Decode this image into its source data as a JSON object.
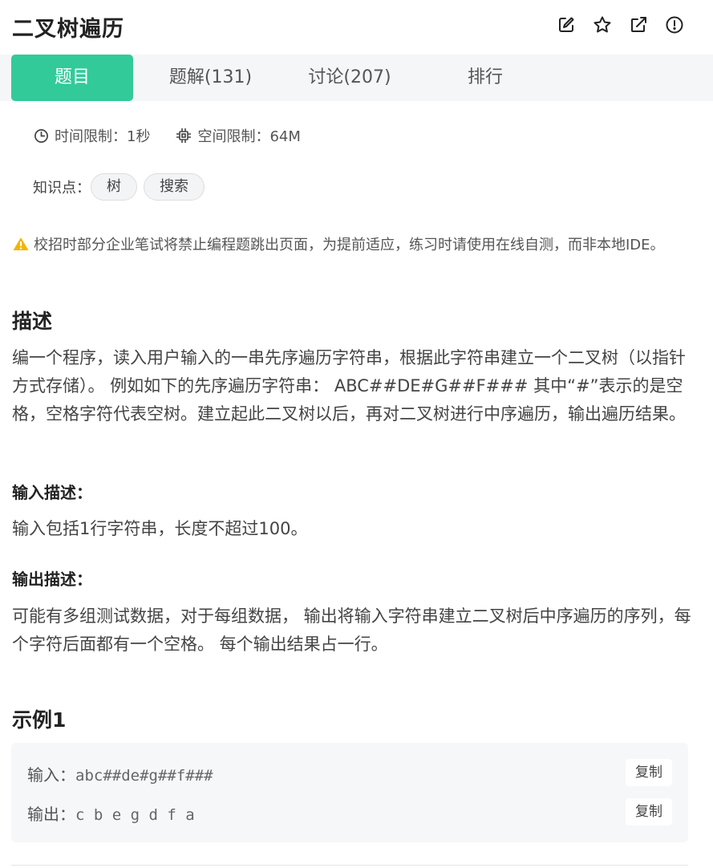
{
  "header": {
    "title": "二叉树遍历",
    "icons": [
      "edit-icon",
      "star-icon",
      "external-link-icon",
      "info-icon"
    ]
  },
  "tabs": [
    {
      "label": "题目",
      "active": true
    },
    {
      "label": "题解(131)",
      "active": false
    },
    {
      "label": "讨论(207)",
      "active": false
    },
    {
      "label": "排行",
      "active": false
    }
  ],
  "meta": {
    "time_limit": "时间限制：1秒",
    "space_limit": "空间限制：64M"
  },
  "knowledge": {
    "label": "知识点：",
    "tags": [
      "树",
      "搜索"
    ]
  },
  "notice": "校招时部分企业笔试将禁止编程题跳出页面，为提前适应，练习时请使用在线自测，而非本地IDE。",
  "description": {
    "heading": "描述",
    "text": "编一个程序，读入用户输入的一串先序遍历字符串，根据此字符串建立一个二叉树（以指针方式存储）。 例如如下的先序遍历字符串： ABC##DE#G##F### 其中“#”表示的是空格，空格字符代表空树。建立起此二叉树以后，再对二叉树进行中序遍历，输出遍历结果。"
  },
  "input_desc": {
    "heading": "输入描述：",
    "text": "输入包括1行字符串，长度不超过100。"
  },
  "output_desc": {
    "heading": "输出描述：",
    "text": "可能有多组测试数据，对于每组数据， 输出将输入字符串建立二叉树后中序遍历的序列，每个字符后面都有一个空格。 每个输出结果占一行。"
  },
  "example": {
    "heading": "示例1",
    "input_label": "输入：",
    "input_value": "abc##de#g##f###",
    "output_label": "输出：",
    "output_value": "c b e g d f a",
    "copy_label": "复制"
  },
  "colors": {
    "accent": "#32ca99",
    "warning": "#f5b400"
  }
}
